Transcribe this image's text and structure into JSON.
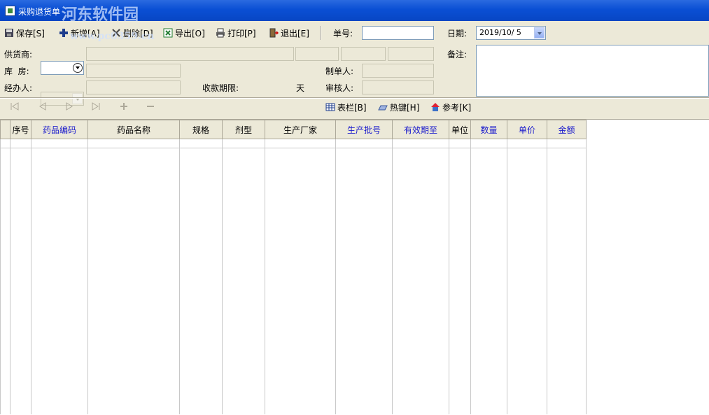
{
  "window": {
    "title": "采购退货单",
    "watermark_line1": "河东软件园",
    "watermark_line2": "www.pc0359.cn"
  },
  "toolbar": {
    "save": "保存[S]",
    "new": "新增[A]",
    "delete": "删除[D]",
    "export": "导出[O]",
    "print": "打印[P]",
    "exit": "退出[E]",
    "order_no_label": "单号:",
    "order_no_value": "",
    "date_label": "日期:",
    "date_value": "2019/10/ 5"
  },
  "form": {
    "supplier_label": "供货商:",
    "warehouse_label": "库  房:",
    "handler_label": "经办人:",
    "payment_term_label": "收款期限:",
    "day_unit": "天",
    "creator_label": "制单人:",
    "reviewer_label": "审核人:",
    "remark_label": "备注:"
  },
  "actions": {
    "columns": "表栏[B]",
    "hotkeys": "热键[H]",
    "reference": "参考[K]"
  },
  "table": {
    "headers": [
      "序号",
      "药品编码",
      "药品名称",
      "规格",
      "剂型",
      "生产厂家",
      "生产批号",
      "有效期至",
      "单位",
      "数量",
      "单价",
      "金额"
    ]
  },
  "colors": {
    "titlebar": "#0a4fd4",
    "panel": "#ece9d8",
    "header_blue": "#1a1acc"
  },
  "icons": [
    "save-icon",
    "plus-icon",
    "delete-icon",
    "excel-icon",
    "printer-icon",
    "exit-door-icon",
    "table-icon",
    "keyboard-icon",
    "reference-icon",
    "nav-first-icon",
    "nav-prev-icon",
    "nav-next-icon",
    "nav-last-icon",
    "nav-add-icon",
    "nav-remove-icon"
  ]
}
